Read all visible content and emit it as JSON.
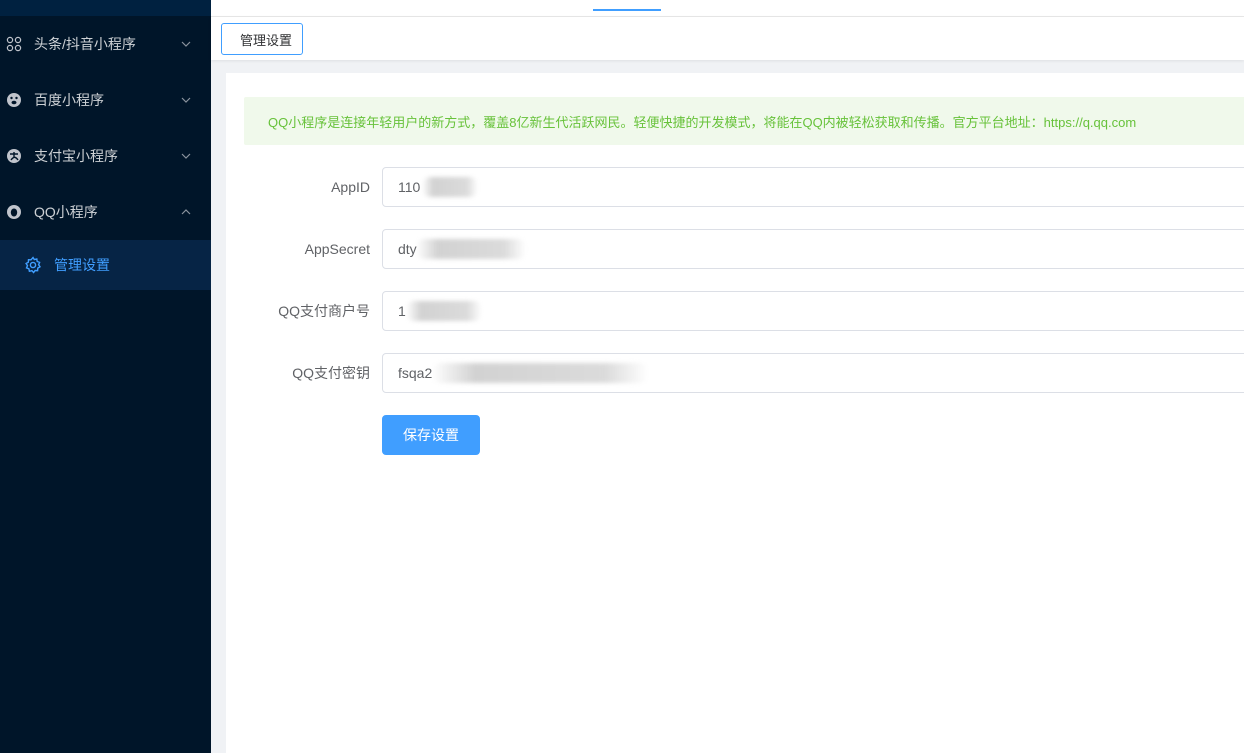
{
  "sidebar": {
    "items": [
      {
        "label": "头条/抖音小程序",
        "icon": "apps-grid-icon",
        "expanded": false
      },
      {
        "label": "百度小程序",
        "icon": "baidu-paw-icon",
        "expanded": false
      },
      {
        "label": "支付宝小程序",
        "icon": "alipay-icon",
        "expanded": false
      },
      {
        "label": "QQ小程序",
        "icon": "qq-icon",
        "expanded": true
      }
    ],
    "submenu": {
      "label": "管理设置",
      "icon": "gear-icon",
      "active": true
    }
  },
  "tags": {
    "active_tag": "管理设置"
  },
  "alert": {
    "text": "QQ小程序是连接年轻用户的新方式，覆盖8亿新生代活跃网民。轻便快捷的开发模式，将能在QQ内被轻松获取和传播。官方平台地址：https://q.qq.com",
    "color": "#67c23a",
    "background": "#f0f9eb"
  },
  "form": {
    "fields": [
      {
        "label": "AppID",
        "value": "110"
      },
      {
        "label": "AppSecret",
        "value": "dty"
      },
      {
        "label": "QQ支付商户号",
        "value": "1"
      },
      {
        "label": "QQ支付密钥",
        "value": "fsqa2"
      }
    ],
    "save_label": "保存设置"
  },
  "colors": {
    "sidebar_bg": "#001529",
    "accent": "#409eff"
  }
}
